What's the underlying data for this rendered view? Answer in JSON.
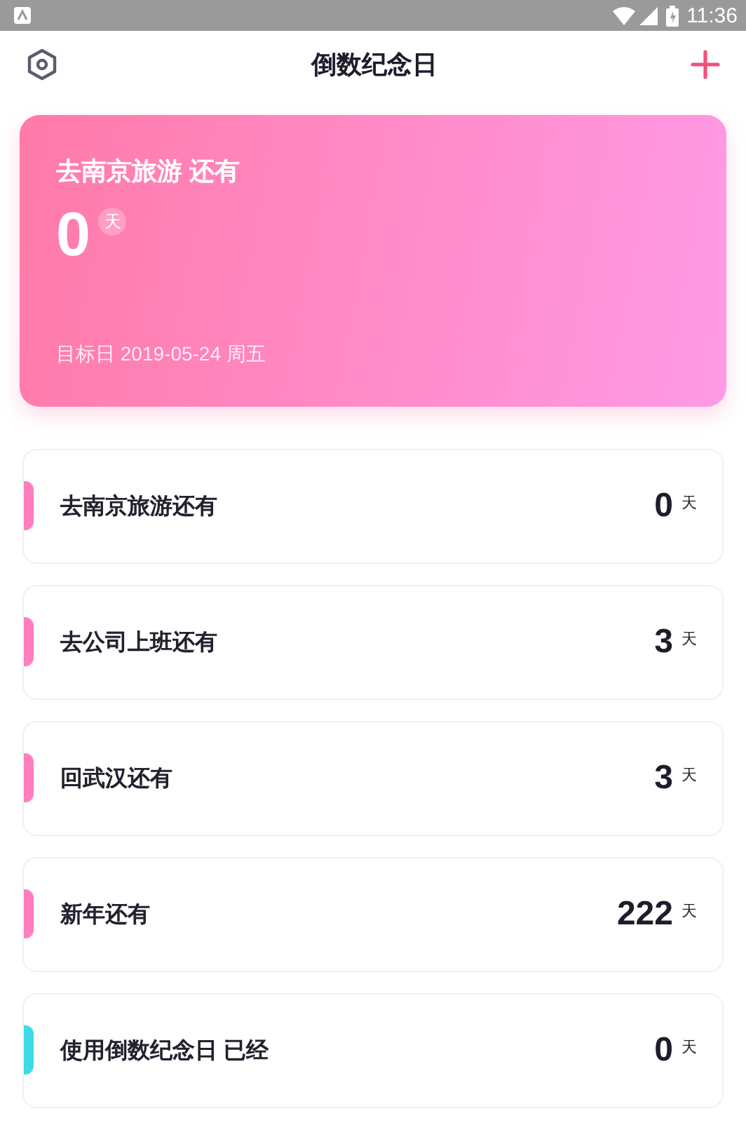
{
  "status_bar": {
    "time": "11:36"
  },
  "header": {
    "title": "倒数纪念日"
  },
  "hero": {
    "title": "去南京旅游 还有",
    "days": "0",
    "unit": "天",
    "target": "目标日 2019-05-24 周五"
  },
  "events": [
    {
      "title": "去南京旅游还有",
      "days": "0",
      "unit": "天",
      "color": "#ff7ec0"
    },
    {
      "title": "去公司上班还有",
      "days": "3",
      "unit": "天",
      "color": "#ff7ec0"
    },
    {
      "title": "回武汉还有",
      "days": "3",
      "unit": "天",
      "color": "#ff7ec0"
    },
    {
      "title": "新年还有",
      "days": "222",
      "unit": "天",
      "color": "#ff7ec0"
    },
    {
      "title": "使用倒数纪念日 已经",
      "days": "0",
      "unit": "天",
      "color": "#3ddbe6"
    }
  ]
}
